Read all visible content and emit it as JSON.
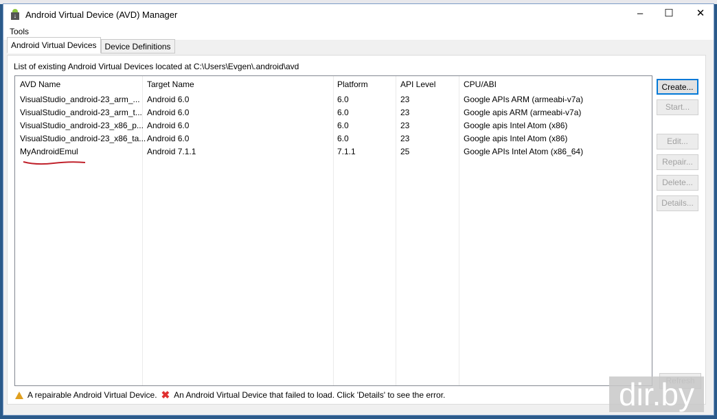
{
  "window": {
    "title": "Android Virtual Device (AVD) Manager",
    "minimize": "–",
    "maximize": "☐",
    "close": "✕"
  },
  "menu": {
    "tools": "Tools"
  },
  "tabs": [
    {
      "label": "Android Virtual Devices"
    },
    {
      "label": "Device Definitions"
    }
  ],
  "list_label": "List of existing Android Virtual Devices located at C:\\Users\\Evgen\\.android\\avd",
  "columns": [
    "AVD Name",
    "Target Name",
    "Platform",
    "API Level",
    "CPU/ABI"
  ],
  "rows": [
    [
      "VisualStudio_android-23_arm_...",
      "Android 6.0",
      "6.0",
      "23",
      "Google APIs ARM (armeabi-v7a)"
    ],
    [
      "VisualStudio_android-23_arm_t...",
      "Android 6.0",
      "6.0",
      "23",
      "Google apis ARM (armeabi-v7a)"
    ],
    [
      "VisualStudio_android-23_x86_p...",
      "Android 6.0",
      "6.0",
      "23",
      "Google apis Intel Atom (x86)"
    ],
    [
      "VisualStudio_android-23_x86_ta...",
      "Android 6.0",
      "6.0",
      "23",
      "Google apis Intel Atom (x86)"
    ],
    [
      "MyAndroidEmul",
      "Android 7.1.1",
      "7.1.1",
      "25",
      "Google APIs Intel Atom (x86_64)"
    ]
  ],
  "buttons": {
    "create": "Create...",
    "start": "Start...",
    "edit": "Edit...",
    "repair": "Repair...",
    "delete": "Delete...",
    "details": "Details...",
    "refresh": "Refresh"
  },
  "legend": {
    "repairable": "A repairable Android Virtual Device.",
    "failed": "An Android Virtual Device that failed to load. Click 'Details' to see the error."
  },
  "watermark": "dir.by"
}
